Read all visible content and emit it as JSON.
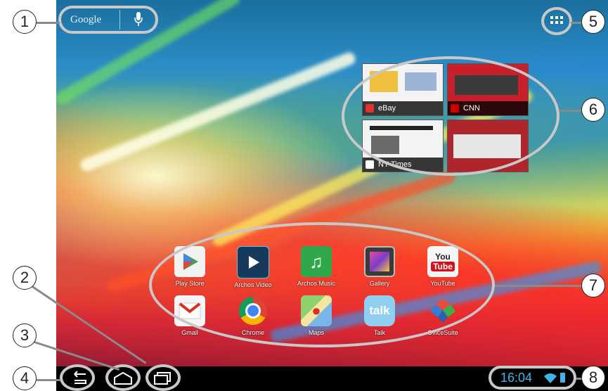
{
  "search": {
    "google_label": "Google"
  },
  "web_thumbs": [
    {
      "label": "eBay",
      "color": "#d33"
    },
    {
      "label": "CNN",
      "color": "#c00"
    },
    {
      "label": "NY Times",
      "color": "#222"
    },
    {
      "label": "",
      "color": "#c00"
    }
  ],
  "apps_row1": [
    "Play Store",
    "Archos Video",
    "Archos Music",
    "Gallery",
    "YouTube"
  ],
  "apps_row2": [
    "Gmail",
    "Chrome",
    "Maps",
    "Talk",
    "OfficeSuite"
  ],
  "status": {
    "time": "16:04"
  },
  "callouts": [
    "1",
    "2",
    "3",
    "4",
    "5",
    "6",
    "7",
    "8"
  ],
  "colors": {
    "clock": "#3fb4e8",
    "highlight": "#c8c8c8"
  }
}
